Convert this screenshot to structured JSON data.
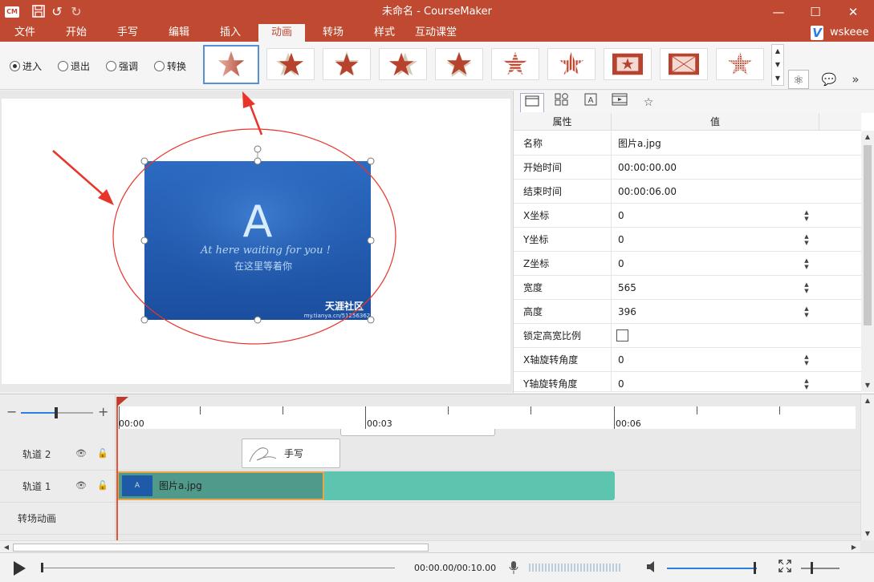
{
  "window": {
    "title": "未命名 - CourseMaker",
    "logo": "CM",
    "minimize": "—",
    "maximize": "☐",
    "close": "✕"
  },
  "tabs": [
    "文件",
    "开始",
    "手写",
    "编辑",
    "插入",
    "动画",
    "转场",
    "样式",
    "互动课堂"
  ],
  "active_tab": "动画",
  "user": {
    "badge": "V",
    "name": "wskeee"
  },
  "ribbon": {
    "radios": [
      {
        "label": "进入",
        "checked": true
      },
      {
        "label": "退出",
        "checked": false
      },
      {
        "label": "强调",
        "checked": false
      },
      {
        "label": "转换",
        "checked": false
      }
    ],
    "thumbnails": [
      "star-fade-icon",
      "star-shadow-icon",
      "star-shadow-icon",
      "star-shadow-icon",
      "star-shadow-icon",
      "star-stripes-icon",
      "star-vertical-stripes-icon",
      "box-frame-icon",
      "box-frame-icon",
      "star-dissolve-icon"
    ]
  },
  "properties": {
    "tabs": [
      "window-icon",
      "shapes-icon",
      "text-icon",
      "film-icon",
      "star-icon"
    ],
    "header_key": "属性",
    "header_value": "值",
    "rows": [
      {
        "key": "名称",
        "value": "图片a.jpg",
        "spin": false
      },
      {
        "key": "开始时间",
        "value": "00:00:00.00",
        "spin": false
      },
      {
        "key": "结束时间",
        "value": "00:00:06.00",
        "spin": false
      },
      {
        "key": "X坐标",
        "value": "0",
        "spin": true
      },
      {
        "key": "Y坐标",
        "value": "0",
        "spin": true
      },
      {
        "key": "Z坐标",
        "value": "0",
        "spin": true
      },
      {
        "key": "宽度",
        "value": "565",
        "spin": true
      },
      {
        "key": "高度",
        "value": "396",
        "spin": true
      },
      {
        "key": "锁定高宽比例",
        "value": "",
        "checkbox": true
      },
      {
        "key": "X轴旋转角度",
        "value": "0",
        "spin": true
      },
      {
        "key": "Y轴旋转角度",
        "value": "0",
        "spin": true
      }
    ]
  },
  "canvas_image": {
    "letter": "A",
    "line1": "At here waiting for you !",
    "line2": "在这里等着你",
    "brand": "天涯社区",
    "url": "my.tianya.cn/51256362"
  },
  "timeline": {
    "ruler_labels": [
      "00:00",
      "00:03",
      "00:06"
    ],
    "tracks": [
      {
        "name": "轨道 2"
      },
      {
        "name": "轨道 1"
      },
      {
        "name": "转场动画"
      }
    ],
    "handwrite_clip": "手写",
    "image_clip": "图片a.jpg",
    "image_clip_thumb": "A"
  },
  "transport": {
    "time": "00:00.00/00:10.00"
  },
  "colors": {
    "brand": "#bf4a31",
    "accent": "#2a7fe0",
    "clip_primary": "#4f9a8a",
    "clip_secondary": "#5dc4b0",
    "annotation": "#e8352a"
  }
}
